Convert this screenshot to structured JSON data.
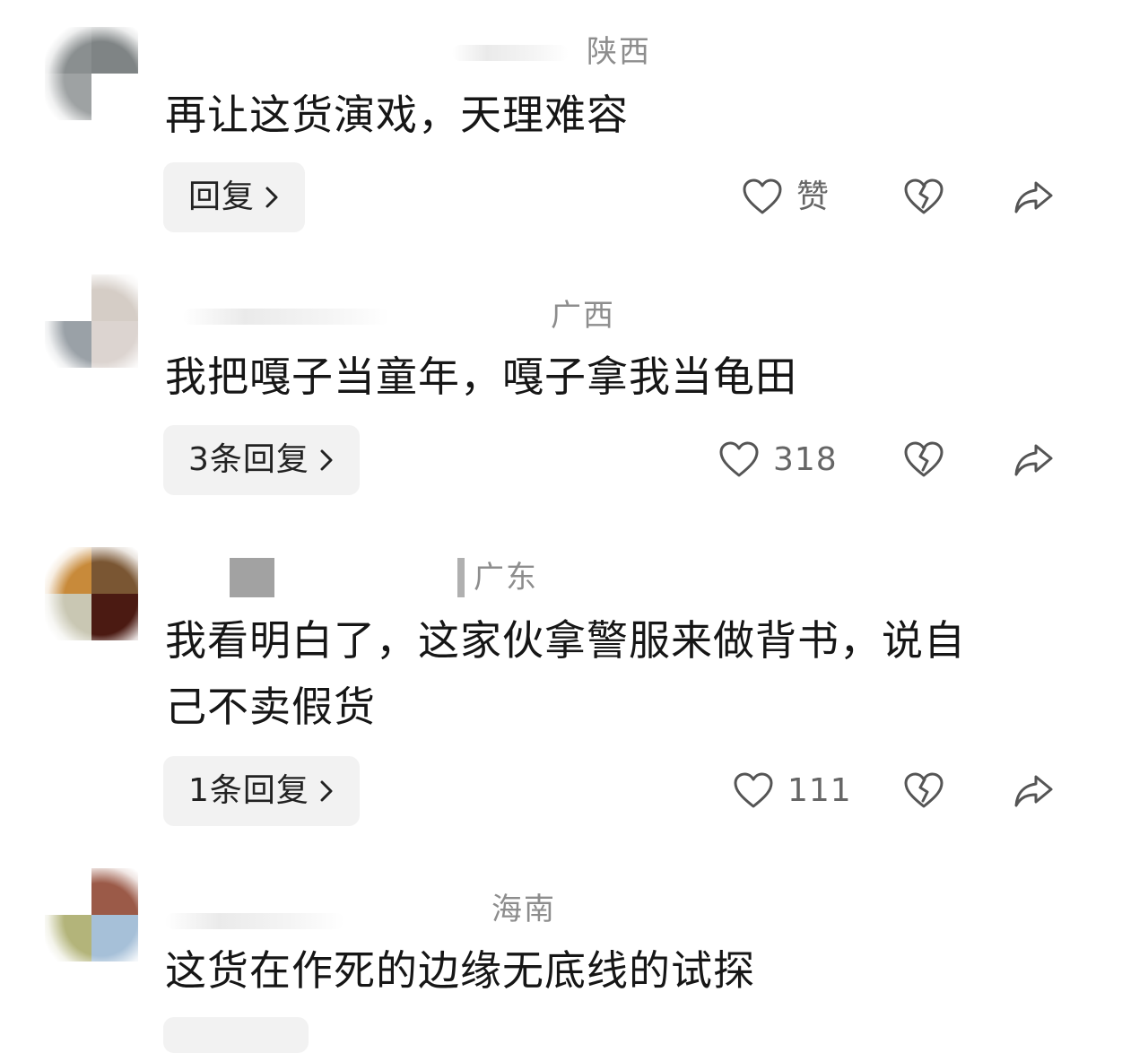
{
  "comments": [
    {
      "location": "陕西",
      "text": "再让这货演戏，天理难容",
      "reply_label": "回复",
      "like_label": "赞"
    },
    {
      "location": "广西",
      "text": "我把嘎子当童年，嘎子拿我当龟田",
      "reply_label": "3条回复",
      "like_label": "318"
    },
    {
      "location": "广东",
      "text_line1": "我看明白了，这家伙拿警服来做背书，说自",
      "text_line2": "己不卖假货",
      "reply_label": "1条回复",
      "like_label": "111"
    },
    {
      "location": "海南",
      "text": "这货在作死的边缘无底线的试探"
    }
  ],
  "icons": {
    "like": "heart-outline-icon",
    "dislike": "broken-heart-icon",
    "share": "share-arrow-icon",
    "reply_chevron": "chevron-right-icon"
  },
  "colors": {
    "location_text": "#8d8d8d",
    "comment_text": "#161616",
    "reply_button_bg": "#f2f2f2",
    "icon_stroke": "#555555",
    "count_text": "#666666"
  }
}
